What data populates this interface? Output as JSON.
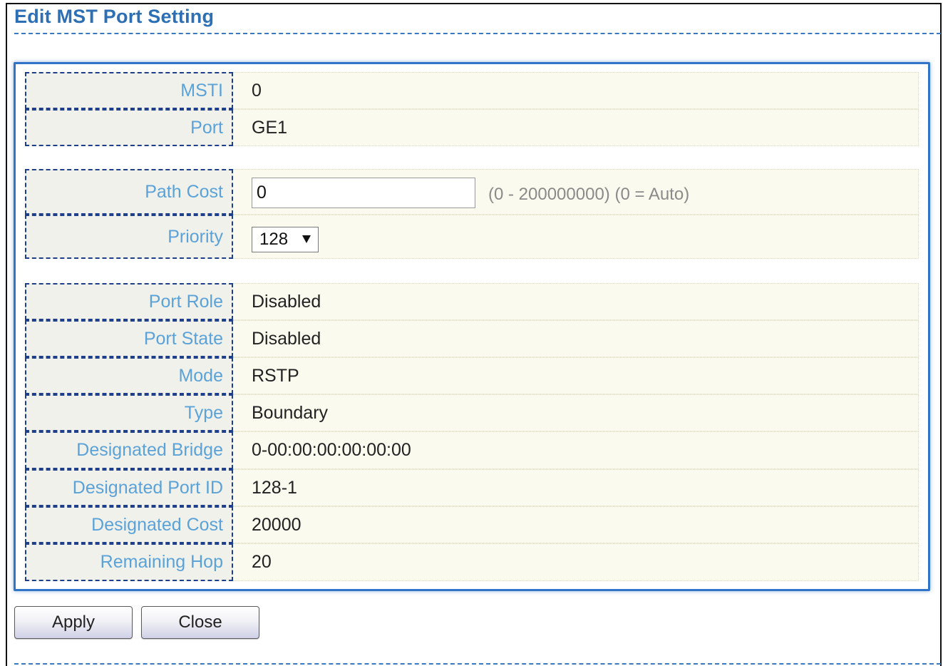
{
  "page": {
    "title": "Edit MST Port Setting"
  },
  "fields": {
    "msti": {
      "label": "MSTI",
      "value": "0"
    },
    "port": {
      "label": "Port",
      "value": "GE1"
    },
    "path_cost": {
      "label": "Path Cost",
      "value": "0",
      "hint": "(0 - 200000000) (0 = Auto)"
    },
    "priority": {
      "label": "Priority",
      "value": "128"
    },
    "port_role": {
      "label": "Port Role",
      "value": "Disabled"
    },
    "port_state": {
      "label": "Port State",
      "value": "Disabled"
    },
    "mode": {
      "label": "Mode",
      "value": "RSTP"
    },
    "type": {
      "label": "Type",
      "value": "Boundary"
    },
    "designated_bridge": {
      "label": "Designated Bridge",
      "value": "0-00:00:00:00:00:00"
    },
    "designated_port_id": {
      "label": "Designated Port ID",
      "value": "128-1"
    },
    "designated_cost": {
      "label": "Designated Cost",
      "value": "20000"
    },
    "remaining_hop": {
      "label": "Remaining Hop",
      "value": "20"
    }
  },
  "buttons": {
    "apply": "Apply",
    "close": "Close"
  },
  "colors": {
    "title": "#2d6fb4",
    "label_text": "#5aa2d8",
    "panel_border": "#2f74c6",
    "value_bg": "#fbfaee",
    "label_bg": "#f1f1ec"
  },
  "icons": {
    "select_arrow": "chevron-down-icon"
  }
}
